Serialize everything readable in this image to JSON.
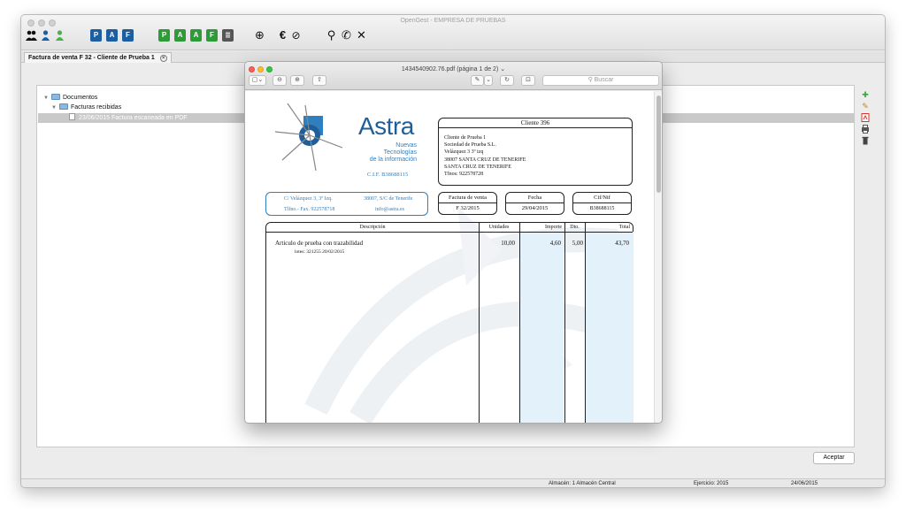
{
  "app": {
    "title": "OpenGest - EMPRESA DE PRUEBAS",
    "tab_label": "Factura de venta F 32 - Cliente de Prueba 1",
    "tab_close": "×"
  },
  "toolbar_icons": [
    "users-icon",
    "user-icon",
    "user-green-icon",
    "doc-p-icon",
    "doc-a-icon",
    "doc-f-icon",
    "doc-green-1-icon",
    "doc-green-2-icon",
    "doc-green-3-icon",
    "doc-green-4-icon",
    "doc-gray-icon",
    "globe-icon",
    "euro-icon",
    "clock-icon",
    "search-icon",
    "phone-icon",
    "tools-icon"
  ],
  "toolbar_glyphs": {
    "doc_p": "P",
    "doc_a": "A",
    "doc_f": "F",
    "doc_g1": "P",
    "doc_g2": "A",
    "doc_g3": "A",
    "doc_g4": "F",
    "doc_gray": "≣",
    "globe": "⊕",
    "euro": "€",
    "clock": "⊘",
    "search": "⚲",
    "phone": "✆",
    "tools": "✕"
  },
  "tree": {
    "root": "Documentos",
    "child": "Facturas recibidas",
    "item": "23/06/2015 Factura escaneada en PDF"
  },
  "accept_label": "Aceptar",
  "status": {
    "almacen": "Almacén: 1 Almacén Central",
    "ejercicio": "Ejercicio: 2015",
    "fecha": "24/06/2015"
  },
  "pdf": {
    "title": "1434540902.76.pdf (página 1 de 2) ⌄",
    "search_placeholder": "Buscar",
    "buttons": {
      "sidebar": "▢⌄",
      "zoom_out": "⊖",
      "zoom_in": "⊕",
      "share": "⇧",
      "markup": "✎",
      "markup_menu": "⌄",
      "rotate": "↻",
      "toolbox": "⊡"
    }
  },
  "invoice": {
    "company": "Astra",
    "tagline_1": "Nuevas Tecnologías",
    "tagline_2": "de la información",
    "cif_company": "C.I.F. B38688115",
    "address_line": "C/ Velázquez 3, 3º Izq.",
    "city_line": "38007, S/C de Tenerife",
    "phone_line": "Tlfno.- Fax. 922578718",
    "email_line": "info@astra.es",
    "client_header": "Cliente  396",
    "client_lines": [
      "Cliente de Prueba 1",
      "Sociedad de Prueba S.L.",
      "Velázquez 3 3º izq",
      "38007 SANTA CRUZ DE TENERIFE",
      "SANTA CRUZ DE TENERIFE",
      "Tfnos: 922578728"
    ],
    "factura_label": "Factura de venta",
    "factura_value": "F 32/2015",
    "fecha_label": "Fecha",
    "fecha_value": "29/04/2015",
    "cif_label": "Cif/Nif",
    "cif_value": "B38688115",
    "table": {
      "headers": [
        "Descripción",
        "Unidades",
        "Importe",
        "Dto.",
        "Total"
      ],
      "row": {
        "descripcion": "Articulo de prueba con trazabilidad",
        "lotes": "lotes:  321255 20/02/2015",
        "unidades": "10,00",
        "importe": "4,60",
        "dto": "5,00",
        "total": "43,70"
      }
    }
  },
  "side_icons": [
    "add-icon",
    "edit-icon",
    "pdf-icon",
    "print-icon",
    "delete-icon"
  ],
  "colors": {
    "accent_blue": "#2f7fbf",
    "table_blue": "#e2f1fa",
    "side_green": "#37a83a",
    "side_red": "#d9342b"
  }
}
